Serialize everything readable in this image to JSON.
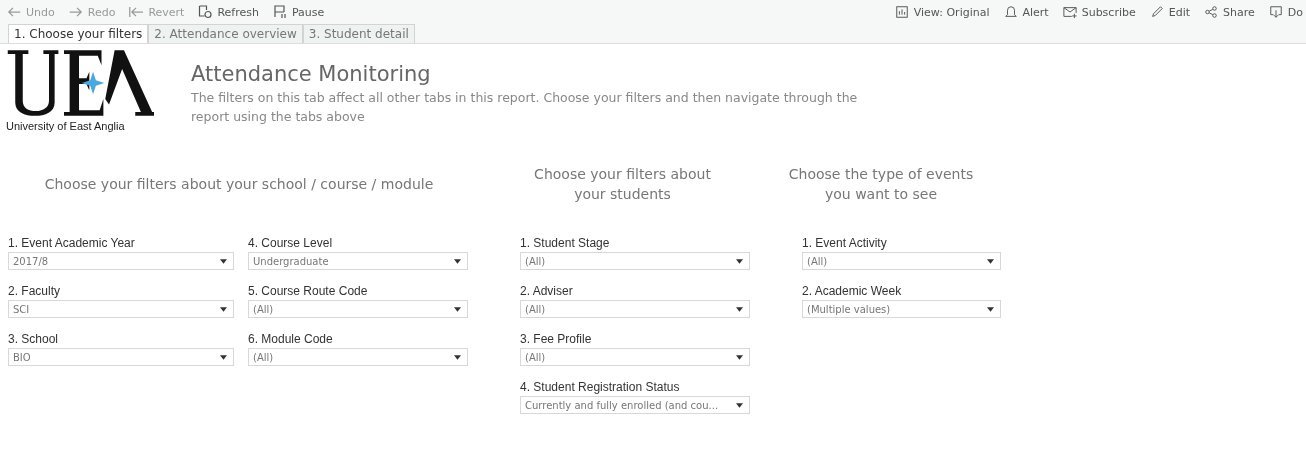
{
  "toolbar": {
    "left": [
      {
        "kind": "undo",
        "label": "Undo",
        "disabled": true
      },
      {
        "kind": "redo",
        "label": "Redo",
        "disabled": true
      },
      {
        "kind": "revert",
        "label": "Revert",
        "disabled": true
      },
      {
        "kind": "refresh",
        "label": "Refresh",
        "disabled": false
      },
      {
        "kind": "pause",
        "label": "Pause",
        "disabled": false
      }
    ],
    "right": [
      {
        "kind": "view",
        "label": "View: Original",
        "disabled": false
      },
      {
        "kind": "alert",
        "label": "Alert",
        "disabled": false
      },
      {
        "kind": "subscribe",
        "label": "Subscribe",
        "disabled": false
      },
      {
        "kind": "edit",
        "label": "Edit",
        "disabled": false
      },
      {
        "kind": "share",
        "label": "Share",
        "disabled": false
      },
      {
        "kind": "download",
        "label": "Do",
        "disabled": false
      }
    ]
  },
  "tabs": [
    {
      "label": "1. Choose your filters",
      "selected": true
    },
    {
      "label": "2. Attendance overview",
      "selected": false
    },
    {
      "label": "3. Student detail",
      "selected": false
    }
  ],
  "logo": {
    "caption": "University of East Anglia"
  },
  "title": "Attendance Monitoring",
  "description": "The filters on this tab affect all other tabs in this report. Choose your filters and then navigate through the report using the tabs above",
  "sections": [
    {
      "heading": "Choose your filters about your school / course / module",
      "columns": [
        [
          {
            "label": "1. Event Academic Year",
            "value": "2017/8"
          },
          {
            "label": "2. Faculty",
            "value": "SCI"
          },
          {
            "label": "3. School",
            "value": "BIO"
          }
        ],
        [
          {
            "label": "4. Course Level",
            "value": "Undergraduate"
          },
          {
            "label": "5. Course Route Code",
            "value": "(All)"
          },
          {
            "label": "6. Module Code",
            "value": "(All)"
          }
        ]
      ]
    },
    {
      "heading": "Choose your filters about your students",
      "columns": [
        [
          {
            "label": "1. Student Stage",
            "value": "(All)"
          },
          {
            "label": "2. Adviser",
            "value": "(All)"
          },
          {
            "label": "3. Fee Profile",
            "value": "(All)"
          },
          {
            "label": "4. Student Registration Status",
            "value": "Currently and fully enrolled (and cou..."
          }
        ]
      ]
    },
    {
      "heading": "Choose the type of events you want to see",
      "columns": [
        [
          {
            "label": "1. Event Activity",
            "value": "(All)"
          },
          {
            "label": "2. Academic Week",
            "value": "(Multiple values)"
          }
        ]
      ]
    }
  ]
}
